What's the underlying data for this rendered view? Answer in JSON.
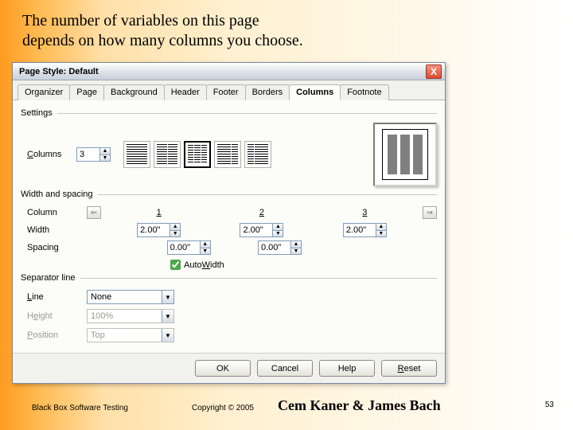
{
  "slide": {
    "text_line1": "The number of variables on this page",
    "text_line2": "depends on how many columns you choose."
  },
  "dialog": {
    "title": "Page Style: Default",
    "close_x": "X",
    "tabs": [
      "Organizer",
      "Page",
      "Background",
      "Header",
      "Footer",
      "Borders",
      "Columns",
      "Footnote"
    ],
    "active_tab": "Columns",
    "settings": {
      "group": "Settings",
      "columns_label": "Columns",
      "columns_value": "3"
    },
    "width_spacing": {
      "group": "Width and spacing",
      "column_label": "Column",
      "width_label": "Width",
      "spacing_label": "Spacing",
      "col_headers": [
        "1",
        "2",
        "3"
      ],
      "widths": [
        "2.00\"",
        "2.00\"",
        "2.00\""
      ],
      "spacings": [
        "0.00\"",
        "0.00\""
      ],
      "left_arrow": "⇐",
      "right_arrow": "⇒",
      "autowidth_label": "AutoWidth",
      "autowidth_checked": true
    },
    "separator": {
      "group": "Separator line",
      "line_label": "Line",
      "line_value": "None",
      "height_label": "Height",
      "height_value": "100%",
      "position_label": "Position",
      "position_value": "Top"
    },
    "buttons": {
      "ok": "OK",
      "cancel": "Cancel",
      "help": "Help",
      "reset": "Reset"
    }
  },
  "footer": {
    "left": "Black Box Software Testing",
    "center": "Copyright © 2005",
    "authors": "Cem Kaner & James Bach",
    "page": "53"
  }
}
